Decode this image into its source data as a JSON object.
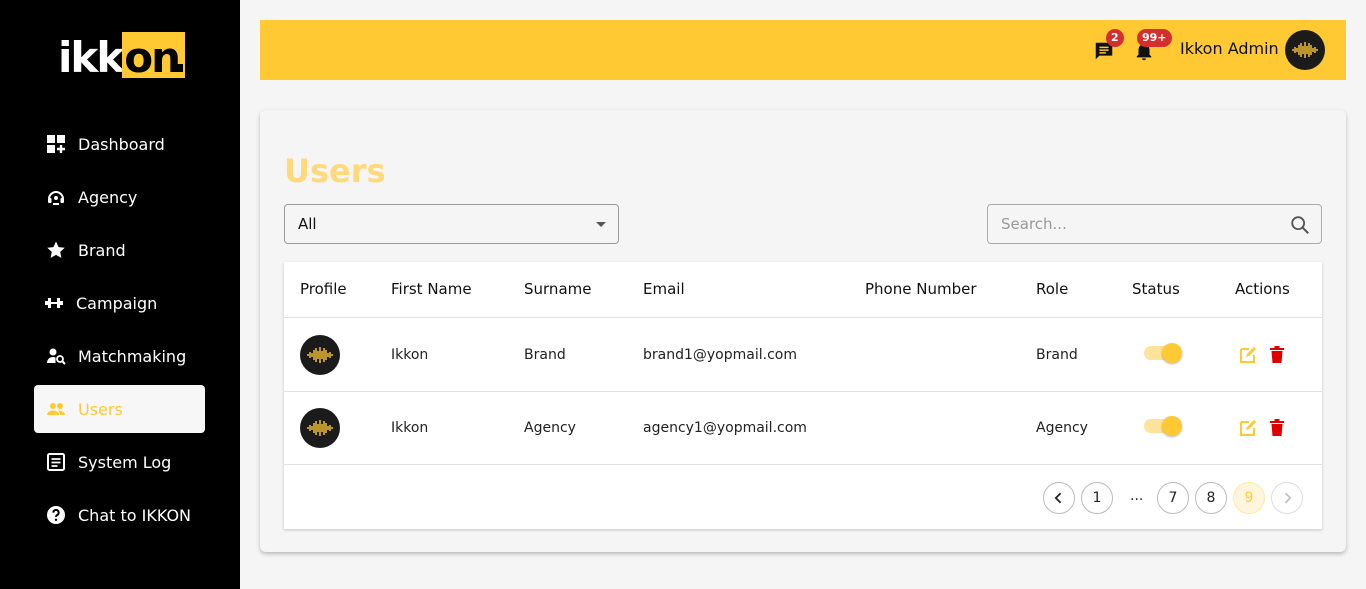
{
  "brand": {
    "logo_text_white": "ikk",
    "logo_text_box": "on"
  },
  "sidebar": {
    "items": [
      {
        "label": "Dashboard",
        "icon": "dashboard-icon"
      },
      {
        "label": "Agency",
        "icon": "agency-icon"
      },
      {
        "label": "Brand",
        "icon": "star-icon"
      },
      {
        "label": "Campaign",
        "icon": "campaign-icon"
      },
      {
        "label": "Matchmaking",
        "icon": "matchmaking-icon"
      },
      {
        "label": "Users",
        "icon": "users-icon",
        "active": true
      },
      {
        "label": "System Log",
        "icon": "system-log-icon"
      },
      {
        "label": "Chat to IKKON",
        "icon": "help-icon"
      }
    ]
  },
  "header": {
    "messages_badge": "2",
    "notifications_badge": "99+",
    "admin_name": "Ikkon Admin"
  },
  "main": {
    "title": "Users",
    "filter": {
      "selected": "All"
    },
    "search": {
      "placeholder": "Search..."
    },
    "columns": [
      "Profile",
      "First Name",
      "Surname",
      "Email",
      "Phone Number",
      "Role",
      "Status",
      "Actions"
    ],
    "rows": [
      {
        "first_name": "Ikkon",
        "surname": "Brand",
        "email": "brand1@yopmail.com",
        "phone": "",
        "role": "Brand",
        "status": true
      },
      {
        "first_name": "Ikkon",
        "surname": "Agency",
        "email": "agency1@yopmail.com",
        "phone": "",
        "role": "Agency",
        "status": true
      }
    ],
    "pagination": {
      "pages": [
        "1",
        "...",
        "7",
        "8",
        "9"
      ],
      "current": "9"
    }
  },
  "colors": {
    "accent": "#ffc933",
    "title": "#ffd97a",
    "delete": "#e00000",
    "badge": "#d32f2f"
  }
}
